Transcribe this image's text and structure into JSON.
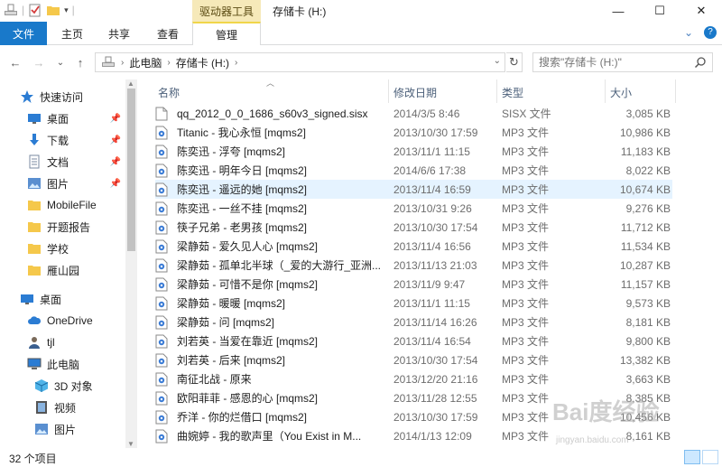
{
  "titlebar": {
    "context_group": "驱动器工具",
    "title": "存储卡 (H:)",
    "minimize": "—",
    "maximize": "☐",
    "close": "✕"
  },
  "ribbon": {
    "tabs": [
      {
        "label": "文件"
      },
      {
        "label": "主页"
      },
      {
        "label": "共享"
      },
      {
        "label": "查看"
      },
      {
        "label": "管理"
      }
    ],
    "collapse_glyph": "⌄",
    "help_glyph": "?"
  },
  "nav": {
    "back": "←",
    "forward": "→",
    "recent": "⌄",
    "up": "↑",
    "crumbs": [
      "此电脑",
      "存储卡 (H:)"
    ],
    "dropdown": "⌄",
    "refresh": "↻"
  },
  "search": {
    "placeholder": "搜索\"存储卡 (H:)\"",
    "icon": "search-icon"
  },
  "sidebar": {
    "items": [
      {
        "label": "快速访问",
        "icon": "star-icon"
      },
      {
        "label": "桌面",
        "icon": "desktop-icon",
        "pinned": true
      },
      {
        "label": "下载",
        "icon": "download-icon",
        "pinned": true
      },
      {
        "label": "文档",
        "icon": "document-icon",
        "pinned": true
      },
      {
        "label": "图片",
        "icon": "picture-icon",
        "pinned": true
      },
      {
        "label": "MobileFile",
        "icon": "folder-icon"
      },
      {
        "label": "开题报告",
        "icon": "folder-icon"
      },
      {
        "label": "学校",
        "icon": "folder-icon"
      },
      {
        "label": "雁山园",
        "icon": "folder-icon"
      },
      {
        "label": "桌面",
        "icon": "desktop-icon"
      },
      {
        "label": "OneDrive",
        "icon": "cloud-icon"
      },
      {
        "label": "tjl",
        "icon": "user-icon"
      },
      {
        "label": "此电脑",
        "icon": "computer-icon"
      },
      {
        "label": "3D 对象",
        "icon": "cube-icon"
      },
      {
        "label": "视频",
        "icon": "video-icon"
      },
      {
        "label": "图片",
        "icon": "picture-icon"
      }
    ]
  },
  "columns": {
    "name": "名称",
    "date": "修改日期",
    "type": "类型",
    "size": "大小"
  },
  "files": [
    {
      "name": "qq_2012_0_0_1686_s60v3_signed.sisx",
      "date": "2014/3/5 8:46",
      "type": "SISX 文件",
      "size": "3,085 KB",
      "icon": "file-icon"
    },
    {
      "name": "Titanic - 我心永恒 [mqms2]",
      "date": "2013/10/30 17:59",
      "type": "MP3 文件",
      "size": "10,986 KB",
      "icon": "audio-file-icon"
    },
    {
      "name": "陈奕迅 - 浮夸 [mqms2]",
      "date": "2013/11/1 11:15",
      "type": "MP3 文件",
      "size": "11,183 KB",
      "icon": "audio-file-icon"
    },
    {
      "name": "陈奕迅 - 明年今日 [mqms2]",
      "date": "2014/6/6 17:38",
      "type": "MP3 文件",
      "size": "8,022 KB",
      "icon": "audio-file-icon"
    },
    {
      "name": "陈奕迅 - 遥远的她 [mqms2]",
      "date": "2013/11/4 16:59",
      "type": "MP3 文件",
      "size": "10,674 KB",
      "icon": "audio-file-icon",
      "highlighted": true
    },
    {
      "name": "陈奕迅 - 一丝不挂 [mqms2]",
      "date": "2013/10/31 9:26",
      "type": "MP3 文件",
      "size": "9,276 KB",
      "icon": "audio-file-icon"
    },
    {
      "name": "筷子兄弟 - 老男孩 [mqms2]",
      "date": "2013/10/30 17:54",
      "type": "MP3 文件",
      "size": "11,712 KB",
      "icon": "audio-file-icon"
    },
    {
      "name": "梁静茹 - 爱久见人心 [mqms2]",
      "date": "2013/11/4 16:56",
      "type": "MP3 文件",
      "size": "11,534 KB",
      "icon": "audio-file-icon"
    },
    {
      "name": "梁静茹 - 孤单北半球（_爱的大游行_亚洲...",
      "date": "2013/11/13 21:03",
      "type": "MP3 文件",
      "size": "10,287 KB",
      "icon": "audio-file-icon"
    },
    {
      "name": "梁静茹 - 可惜不是你 [mqms2]",
      "date": "2013/11/9 9:47",
      "type": "MP3 文件",
      "size": "11,157 KB",
      "icon": "audio-file-icon"
    },
    {
      "name": "梁静茹 - 暖暖 [mqms2]",
      "date": "2013/11/1 11:15",
      "type": "MP3 文件",
      "size": "9,573 KB",
      "icon": "audio-file-icon"
    },
    {
      "name": "梁静茹 - 问 [mqms2]",
      "date": "2013/11/14 16:26",
      "type": "MP3 文件",
      "size": "8,181 KB",
      "icon": "audio-file-icon"
    },
    {
      "name": "刘若英 - 当爱在靠近 [mqms2]",
      "date": "2013/11/4 16:54",
      "type": "MP3 文件",
      "size": "9,800 KB",
      "icon": "audio-file-icon"
    },
    {
      "name": "刘若英 - 后来 [mqms2]",
      "date": "2013/10/30 17:54",
      "type": "MP3 文件",
      "size": "13,382 KB",
      "icon": "audio-file-icon"
    },
    {
      "name": "南征北战 - 原来",
      "date": "2013/12/20 21:16",
      "type": "MP3 文件",
      "size": "3,663 KB",
      "icon": "audio-file-icon"
    },
    {
      "name": "欧阳菲菲 - 感恩的心 [mqms2]",
      "date": "2013/11/28 12:55",
      "type": "MP3 文件",
      "size": "8,385 KB",
      "icon": "audio-file-icon"
    },
    {
      "name": "乔洋 - 你的烂借口 [mqms2]",
      "date": "2013/10/30 17:59",
      "type": "MP3 文件",
      "size": "10,456 KB",
      "icon": "audio-file-icon"
    },
    {
      "name": "曲婉婷 - 我的歌声里（You  Exist  in  M...",
      "date": "2014/1/13 12:09",
      "type": "MP3 文件",
      "size": "8,161 KB",
      "icon": "audio-file-icon"
    }
  ],
  "status": {
    "count": "32 个项目"
  },
  "watermark": {
    "text": "Bai度经验",
    "sub": "jingyan.baidu.com"
  },
  "colors": {
    "file_tab": "#1979ca",
    "context_tab": "#f6e9b9",
    "highlight_row": "#e5f3ff",
    "header_text": "#4c607a"
  }
}
